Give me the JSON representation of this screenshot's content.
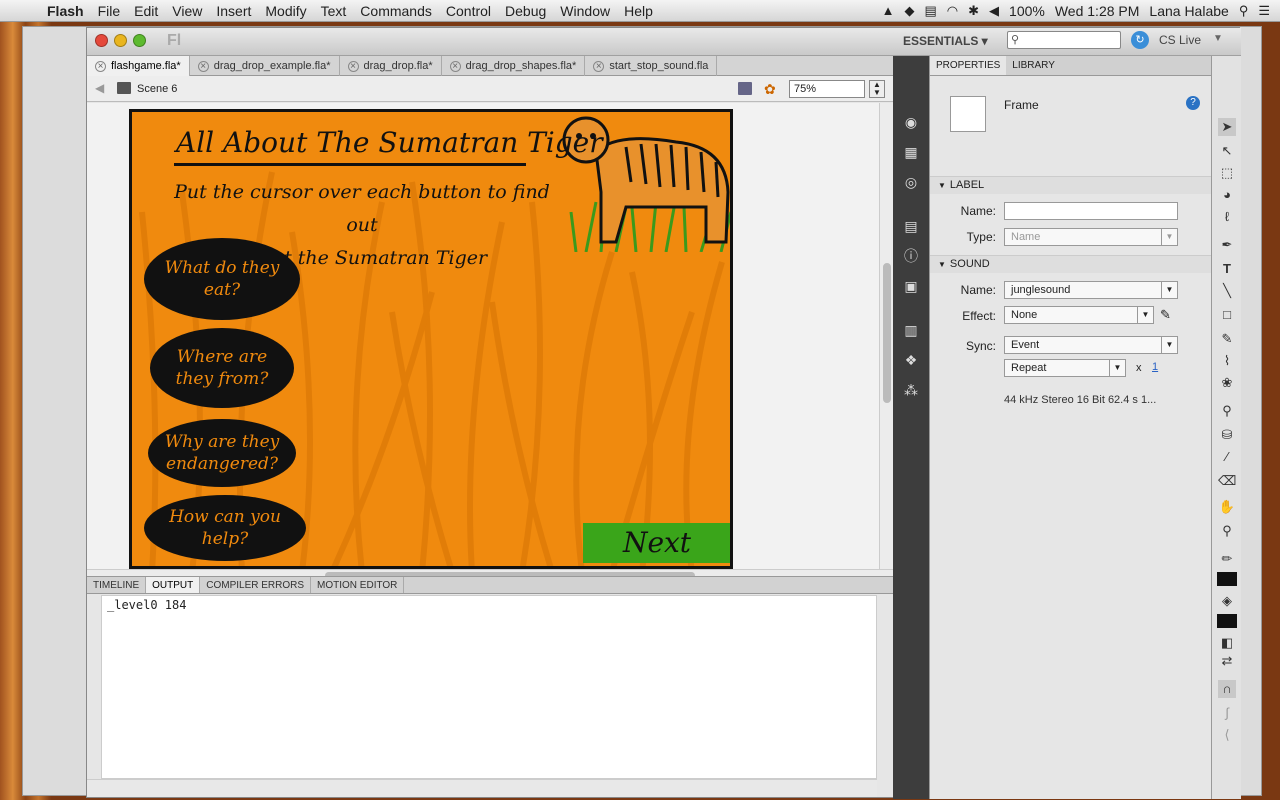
{
  "menubar": {
    "app": "Flash",
    "items": [
      "File",
      "Edit",
      "View",
      "Insert",
      "Modify",
      "Text",
      "Commands",
      "Control",
      "Debug",
      "Window",
      "Help"
    ],
    "battery": "100%",
    "clock": "Wed 1:28 PM",
    "user": "Lana Halabe"
  },
  "titlebar": {
    "logo": "Fl",
    "workspace": "ESSENTIALS ▾",
    "cs_live": "CS Live"
  },
  "doc_tabs": [
    "flashgame.fla*",
    "drag_drop_example.fla*",
    "drag_drop.fla*",
    "drag_drop_shapes.fla*",
    "start_stop_sound.fla"
  ],
  "scene": {
    "label": "Scene 6",
    "zoom": "75%"
  },
  "stage": {
    "title": "All About The Sumatran Tiger",
    "subtitle_line1": "Put the cursor over each button to find out",
    "subtitle_line2": "about the Sumatran Tiger",
    "buttons": [
      "What do they eat?",
      "Where are they from?",
      "Why are they endangered?",
      "How can you help?"
    ],
    "btn2_l1": "Where are",
    "btn2_l2": "they from?",
    "btn3_l1": "Why are they",
    "btn3_l2": "endangered?",
    "next": "Next",
    "colors": {
      "bg": "#f08a0e",
      "next": "#3aa51a"
    }
  },
  "panel_tabs": [
    "TIMELINE",
    "OUTPUT",
    "COMPILER ERRORS",
    "MOTION EDITOR"
  ],
  "output": {
    "text": "_level0 184"
  },
  "properties": {
    "tabs": [
      "PROPERTIES",
      "LIBRARY"
    ],
    "type": "Frame",
    "label_section": "LABEL",
    "name_label": "Name:",
    "name_value": "",
    "type_label": "Type:",
    "type_value": "Name",
    "sound_section": "SOUND",
    "sound_name_label": "Name:",
    "sound_name": "junglesound",
    "effect_label": "Effect:",
    "effect": "None",
    "sync_label": "Sync:",
    "sync": "Event",
    "repeat": "Repeat",
    "repeat_x": "x",
    "repeat_count": "1",
    "info": "44 kHz Stereo 16 Bit 62.4 s 1..."
  }
}
